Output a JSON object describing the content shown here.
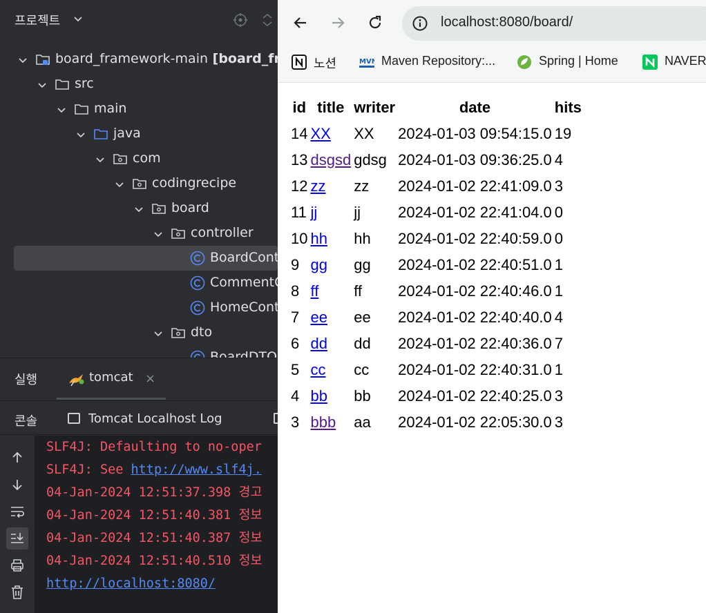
{
  "ide": {
    "project_panel_title": "프로젝트",
    "tree": [
      {
        "label": "board_framework-main",
        "bold_suffix": "[board_fra",
        "icon": "module-icon",
        "level": 0,
        "expanded": true
      },
      {
        "label": "src",
        "icon": "folder-icon",
        "level": 1,
        "expanded": true
      },
      {
        "label": "main",
        "icon": "folder-icon",
        "level": 2,
        "expanded": true
      },
      {
        "label": "java",
        "icon": "source-folder-icon",
        "level": 3,
        "expanded": true
      },
      {
        "label": "com",
        "icon": "package-icon",
        "level": 4,
        "expanded": true
      },
      {
        "label": "codingrecipe",
        "icon": "package-icon",
        "level": 5,
        "expanded": true
      },
      {
        "label": "board",
        "icon": "package-icon",
        "level": 6,
        "expanded": true
      },
      {
        "label": "controller",
        "icon": "package-icon",
        "level": 7,
        "expanded": true
      },
      {
        "label": "BoardCont",
        "icon": "class-icon",
        "level": 8,
        "selected": true
      },
      {
        "label": "CommentC",
        "icon": "class-icon",
        "level": 8
      },
      {
        "label": "HomeCont",
        "icon": "class-icon",
        "level": 8
      },
      {
        "label": "dto",
        "icon": "package-icon",
        "level": 7,
        "expanded": true
      },
      {
        "label": "BoardDTO",
        "icon": "class-icon",
        "level": 8
      }
    ],
    "run_tab_label": "실행",
    "run_config_tab": "tomcat",
    "console_tab_label": "콘솔",
    "log_tab_label": "Tomcat Localhost Log",
    "console_lines": [
      {
        "text": "SLF4J: Defaulting to no-oper"
      },
      {
        "prefix": "SLF4J: See ",
        "link": "http://www.slf4j."
      },
      {
        "text": "04-Jan-2024 12:51:37.398 경고"
      },
      {
        "text": "04-Jan-2024 12:51:40.381 정보"
      },
      {
        "text": "04-Jan-2024 12:51:40.387 정보"
      },
      {
        "text": "04-Jan-2024 12:51:40.510 정보"
      },
      {
        "link": "http://localhost:8080/"
      }
    ],
    "colors": {
      "panel_bg": "#2b2d30",
      "console_bg": "#1e1f22",
      "error_text": "#f75464",
      "link": "#548af7"
    }
  },
  "browser": {
    "url": "localhost:8080/board/",
    "bookmarks": [
      {
        "label": "노션",
        "icon": "notion-icon"
      },
      {
        "label": "Maven Repository:...",
        "icon": "maven-icon"
      },
      {
        "label": "Spring | Home",
        "icon": "spring-icon"
      },
      {
        "label": "NAVER",
        "icon": "naver-icon"
      }
    ],
    "table": {
      "headers": [
        "id",
        "title",
        "writer",
        "date",
        "hits"
      ],
      "rows": [
        {
          "id": "14",
          "title": "XX",
          "writer": "XX",
          "date": "2024-01-03 09:54:15.0",
          "hits": "19",
          "visited": false
        },
        {
          "id": "13",
          "title": "dsgsd",
          "writer": "gdsg",
          "date": "2024-01-03 09:36:25.0",
          "hits": "4",
          "visited": true
        },
        {
          "id": "12",
          "title": "zz",
          "writer": "zz",
          "date": "2024-01-02 22:41:09.0",
          "hits": "3",
          "visited": false
        },
        {
          "id": "11",
          "title": "jj",
          "writer": "jj",
          "date": "2024-01-02 22:41:04.0",
          "hits": "0",
          "visited": false
        },
        {
          "id": "10",
          "title": "hh",
          "writer": "hh",
          "date": "2024-01-02 22:40:59.0",
          "hits": "0",
          "visited": false
        },
        {
          "id": "9",
          "title": "gg",
          "writer": "gg",
          "date": "2024-01-02 22:40:51.0",
          "hits": "1",
          "visited": false
        },
        {
          "id": "8",
          "title": "ff",
          "writer": "ff",
          "date": "2024-01-02 22:40:46.0",
          "hits": "1",
          "visited": false
        },
        {
          "id": "7",
          "title": "ee",
          "writer": "ee",
          "date": "2024-01-02 22:40:40.0",
          "hits": "4",
          "visited": false
        },
        {
          "id": "6",
          "title": "dd",
          "writer": "dd",
          "date": "2024-01-02 22:40:36.0",
          "hits": "7",
          "visited": false
        },
        {
          "id": "5",
          "title": "cc",
          "writer": "cc",
          "date": "2024-01-02 22:40:31.0",
          "hits": "1",
          "visited": false
        },
        {
          "id": "4",
          "title": "bb",
          "writer": "bb",
          "date": "2024-01-02 22:40:25.0",
          "hits": "3",
          "visited": false
        },
        {
          "id": "3",
          "title": "bbb",
          "writer": "aa",
          "date": "2024-01-02 22:05:30.0",
          "hits": "3",
          "visited": true
        }
      ]
    },
    "colors": {
      "toolbar_bg": "#f4f7f5",
      "link": "#0000ee",
      "visited_link": "#551a8b"
    }
  }
}
